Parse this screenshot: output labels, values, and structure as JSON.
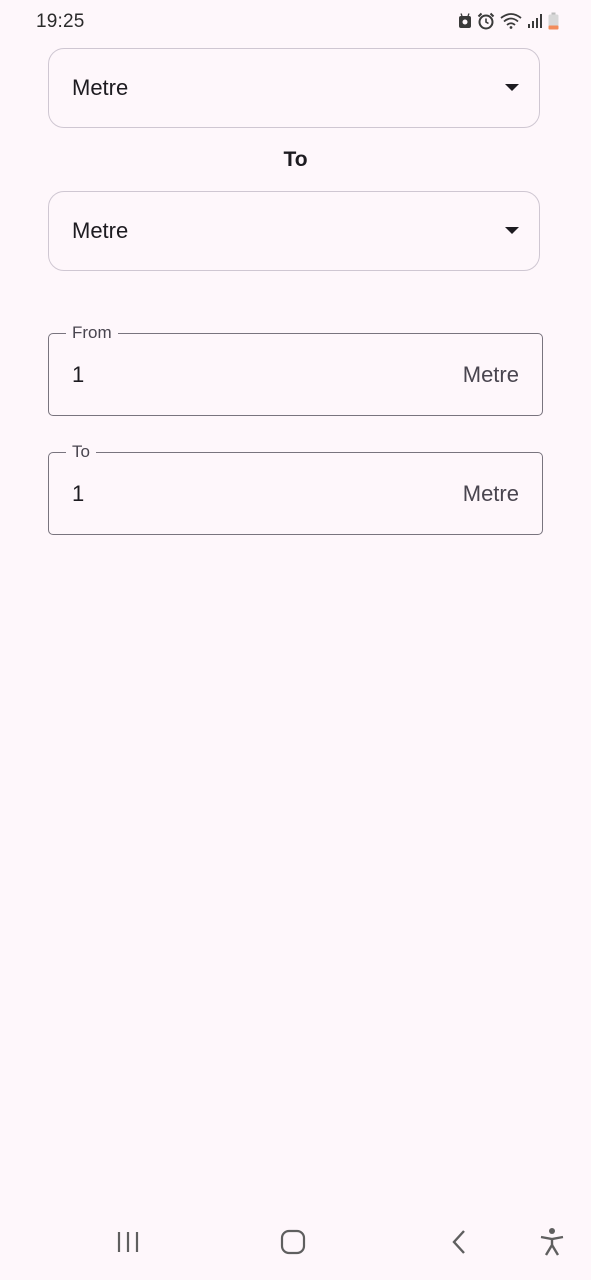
{
  "status_bar": {
    "time": "19:25",
    "icons": [
      "android-notification-icon",
      "alarm-icon",
      "wifi-icon",
      "signal-icon",
      "battery-icon"
    ]
  },
  "converter": {
    "from_unit_select": {
      "selected": "Metre"
    },
    "to_heading": "To",
    "to_unit_select": {
      "selected": "Metre"
    }
  },
  "fields": {
    "from": {
      "label": "From",
      "value": "1",
      "suffix": "Metre"
    },
    "to": {
      "label": "To",
      "value": "1",
      "suffix": "Metre"
    }
  },
  "nav_bar": {
    "icons": [
      "recents-icon",
      "home-icon",
      "back-icon",
      "accessibility-icon"
    ]
  },
  "colors": {
    "background": "#fef7fb",
    "dropdown_border": "#cfc7d2",
    "field_border": "#79747e",
    "text": "#1d1b20",
    "battery_low": "#f28b5a"
  }
}
